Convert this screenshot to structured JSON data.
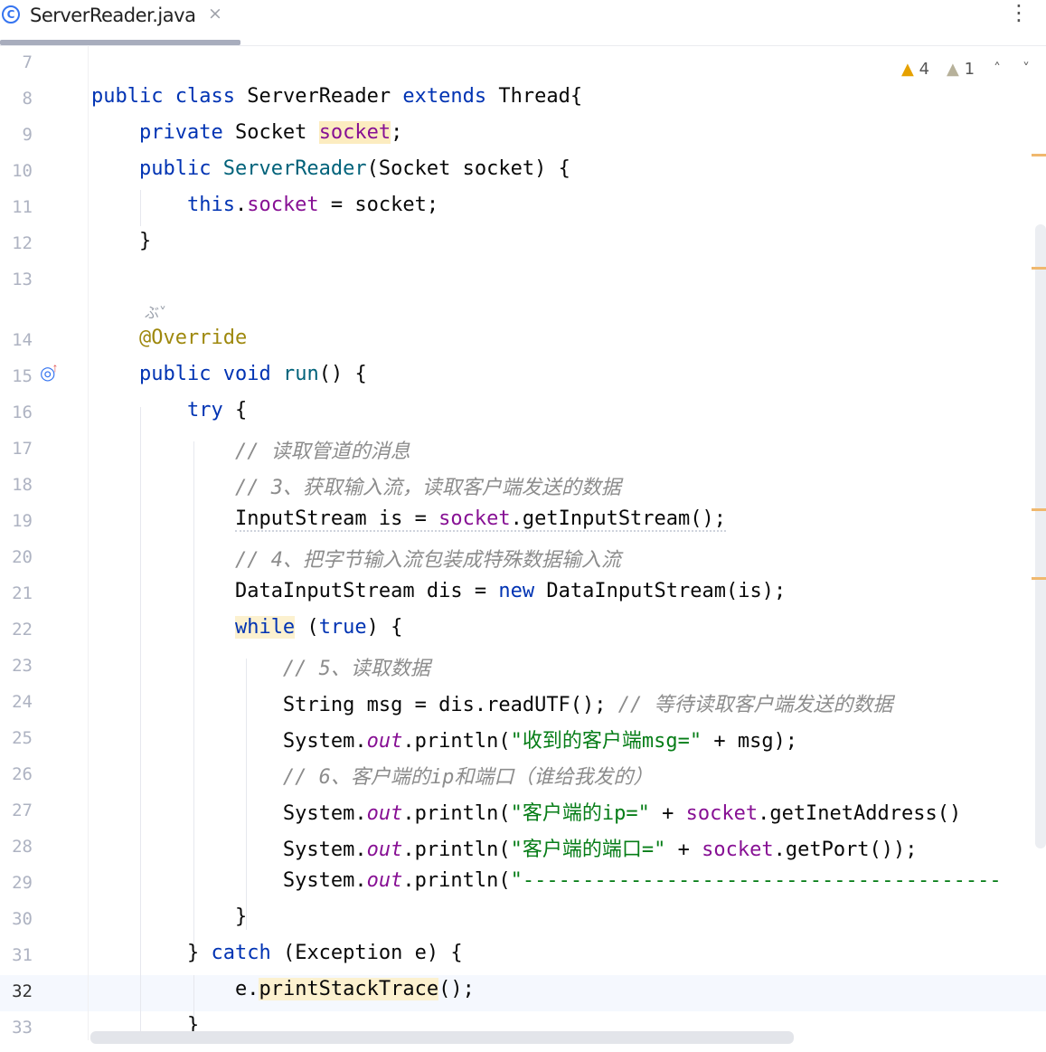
{
  "tab": {
    "icon_letter": "C",
    "title": "ServerReader.java",
    "close_glyph": "×",
    "menu_glyph": "⋮"
  },
  "inspection": {
    "warnings": "4",
    "weak_warnings": "1",
    "warn_glyph": "▲",
    "up_glyph": "˄",
    "down_glyph": "˅"
  },
  "gutter": {
    "override_glyph": "◎",
    "override_arrow": "↑",
    "inlay_hint": "ぶ˅"
  },
  "lines": {
    "n7": "7",
    "n8": "8",
    "n9": "9",
    "n10": "10",
    "n11": "11",
    "n12": "12",
    "n13": "13",
    "n14": "14",
    "n15": "15",
    "n16": "16",
    "n17": "17",
    "n18": "18",
    "n19": "19",
    "n20": "20",
    "n21": "21",
    "n22": "22",
    "n23": "23",
    "n24": "24",
    "n25": "25",
    "n26": "26",
    "n27": "27",
    "n28": "28",
    "n29": "29",
    "n30": "30",
    "n31": "31",
    "n32": "32",
    "n33": "33"
  },
  "code": {
    "l8_kw1": "public",
    "l8_kw2": "class",
    "l8_name": "ServerReader",
    "l8_kw3": "extends",
    "l8_super": "Thread{",
    "l9_kw": "private",
    "l9_type": "Socket",
    "l9_field": "socket",
    "l9_end": ";",
    "l10_kw": "public",
    "l10_ctor": "ServerReader",
    "l10_params": "(Socket socket) {",
    "l11_this": "this",
    "l11_dot": ".",
    "l11_field": "socket",
    "l11_rest": " = socket;",
    "l12": "}",
    "l14_ann": "@Override",
    "l15_kw1": "public",
    "l15_kw2": "void",
    "l15_name": "run",
    "l15_rest": "() {",
    "l16_kw": "try",
    "l16_rest": " {",
    "l17_cm": "// 读取管道的消息",
    "l18_cm": "// 3、获取输入流，读取客户端发送的数据",
    "l19_a": "InputStream is = ",
    "l19_field": "socket",
    "l19_b": ".getInputStream();",
    "l20_cm": "// 4、把字节输入流包装成特殊数据输入流",
    "l21_a": "DataInputStream dis = ",
    "l21_kw": "new",
    "l21_b": " DataInputStream(is);",
    "l22_kw": "while",
    "l22_a": " (",
    "l22_kw2": "true",
    "l22_b": ") {",
    "l23_cm": "// 5、读取数据",
    "l24_a": "String msg = dis.readUTF(); ",
    "l24_cm": "// 等待读取客户端发送的数据",
    "l25_a": "System.",
    "l25_out": "out",
    "l25_b": ".println(",
    "l25_str": "\"收到的客户端msg=\"",
    "l25_c": " + msg);",
    "l26_cm": "// 6、客户端的ip和端口（谁给我发的）",
    "l27_a": "System.",
    "l27_out": "out",
    "l27_b": ".println(",
    "l27_str": "\"客户端的ip=\"",
    "l27_c": " + ",
    "l27_field": "socket",
    "l27_d": ".getInetAddress()",
    "l28_a": "System.",
    "l28_out": "out",
    "l28_b": ".println(",
    "l28_str": "\"客户端的端口=\"",
    "l28_c": " + ",
    "l28_field": "socket",
    "l28_d": ".getPort());",
    "l29_a": "System.",
    "l29_out": "out",
    "l29_b": ".println(",
    "l29_str": "\"----------------------------------------",
    "l30": "}",
    "l31_a": "} ",
    "l31_kw": "catch",
    "l31_b": " (Exception e) {",
    "l32_a": "e.",
    "l32_fn": "printStackTrace",
    "l32_b": "();",
    "l33": "}"
  }
}
